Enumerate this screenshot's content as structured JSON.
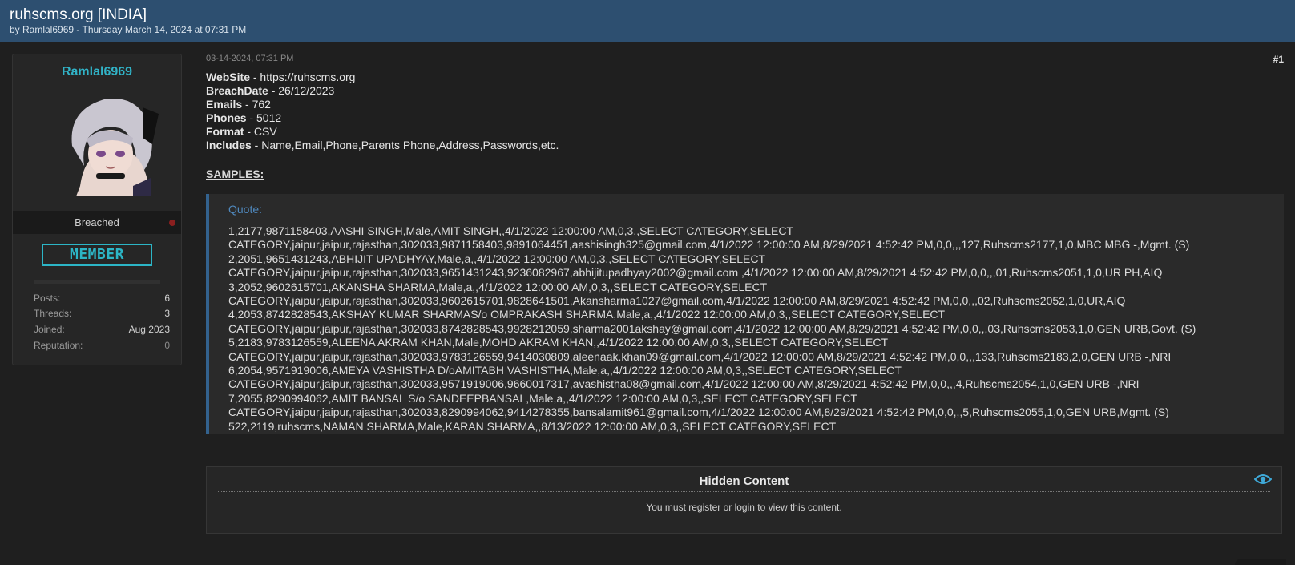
{
  "header": {
    "title": "ruhscms.org [INDIA]",
    "byline": "by Ramlal6969 - Thursday March 14, 2024 at 07:31 PM"
  },
  "user": {
    "username": "Ramlal6969",
    "status": "Breached",
    "rank": "MEMBER",
    "stats": [
      {
        "label": "Posts:",
        "value": "6"
      },
      {
        "label": "Threads:",
        "value": "3"
      },
      {
        "label": "Joined:",
        "value": "Aug 2023"
      },
      {
        "label": "Reputation:",
        "value": "0"
      }
    ]
  },
  "post": {
    "date": "03-14-2024, 07:31 PM",
    "number": "#1",
    "fields": [
      {
        "label": "WebSite",
        "value": " - https://ruhscms.org"
      },
      {
        "label": "BreachDate",
        "value": " - 26/12/2023"
      },
      {
        "label": "Emails",
        "value": " - 762"
      },
      {
        "label": "Phones",
        "value": " - 5012"
      },
      {
        "label": "Format",
        "value": " - CSV"
      },
      {
        "label": "Includes",
        "value": " - Name,Email,Phone,Parents Phone,Address,Passwords,etc."
      }
    ],
    "samples_heading": "SAMPLES:",
    "quote_label": "Quote:",
    "quote_lines": [
      "1,2177,9871158403,AASHI SINGH,Male,AMIT SINGH,,4/1/2022 12:00:00 AM,0,3,,SELECT CATEGORY,SELECT",
      "CATEGORY,jaipur,jaipur,rajasthan,302033,9871158403,9891064451,aashisingh325@gmail.com,4/1/2022 12:00:00 AM,8/29/2021 4:52:42 PM,0,0,,,127,Ruhscms2177,1,0,MBC MBG -,Mgmt. (S)",
      "2,2051,9651431243,ABHIJIT UPADHYAY,Male,a,,4/1/2022 12:00:00 AM,0,3,,SELECT CATEGORY,SELECT",
      "CATEGORY,jaipur,jaipur,rajasthan,302033,9651431243,9236082967,abhijitupadhyay2002@gmail.com ,4/1/2022 12:00:00 AM,8/29/2021 4:52:42 PM,0,0,,,01,Ruhscms2051,1,0,UR PH,AIQ",
      "3,2052,9602615701,AKANSHA SHARMA,Male,a,,4/1/2022 12:00:00 AM,0,3,,SELECT CATEGORY,SELECT",
      "CATEGORY,jaipur,jaipur,rajasthan,302033,9602615701,9828641501,Akansharma1027@gmail.com,4/1/2022 12:00:00 AM,8/29/2021 4:52:42 PM,0,0,,,02,Ruhscms2052,1,0,UR,AIQ",
      "4,2053,8742828543,AKSHAY KUMAR SHARMAS/o OMPRAKASH SHARMA,Male,a,,4/1/2022 12:00:00 AM,0,3,,SELECT CATEGORY,SELECT",
      "CATEGORY,jaipur,jaipur,rajasthan,302033,8742828543,9928212059,sharma2001akshay@gmail.com,4/1/2022 12:00:00 AM,8/29/2021 4:52:42 PM,0,0,,,03,Ruhscms2053,1,0,GEN URB,Govt. (S)",
      "5,2183,9783126559,ALEENA AKRAM KHAN,Male,MOHD AKRAM KHAN,,4/1/2022 12:00:00 AM,0,3,,SELECT CATEGORY,SELECT",
      "CATEGORY,jaipur,jaipur,rajasthan,302033,9783126559,9414030809,aleenaak.khan09@gmail.com,4/1/2022 12:00:00 AM,8/29/2021 4:52:42 PM,0,0,,,133,Ruhscms2183,2,0,GEN URB -,NRI",
      "6,2054,9571919006,AMEYA VASHISTHA D/oAMITABH VASHISTHA,Male,a,,4/1/2022 12:00:00 AM,0,3,,SELECT CATEGORY,SELECT",
      "CATEGORY,jaipur,jaipur,rajasthan,302033,9571919006,9660017317,avashistha08@gmail.com,4/1/2022 12:00:00 AM,8/29/2021 4:52:42 PM,0,0,,,4,Ruhscms2054,1,0,GEN URB -,NRI",
      "7,2055,8290994062,AMIT BANSAL S/o SANDEEPBANSAL,Male,a,,4/1/2022 12:00:00 AM,0,3,,SELECT CATEGORY,SELECT",
      "CATEGORY,jaipur,jaipur,rajasthan,302033,8290994062,9414278355,bansalamit961@gmail.com,4/1/2022 12:00:00 AM,8/29/2021 4:52:42 PM,0,0,,,5,Ruhscms2055,1,0,GEN URB,Mgmt. (S)",
      "522,2119,ruhscms,NAMAN SHARMA,Male,KARAN SHARMA,,8/13/2022 12:00:00 AM,0,3,,SELECT CATEGORY,SELECT"
    ]
  },
  "hidden": {
    "title": "Hidden Content",
    "message": "You must register or login to view this content."
  },
  "colors": {
    "header_bg": "#2d4f70",
    "accent": "#31b3c7",
    "quote_border": "#33628e",
    "status_dot": "#8b1f1f"
  },
  "icons": {
    "hidden": "eye-icon"
  }
}
